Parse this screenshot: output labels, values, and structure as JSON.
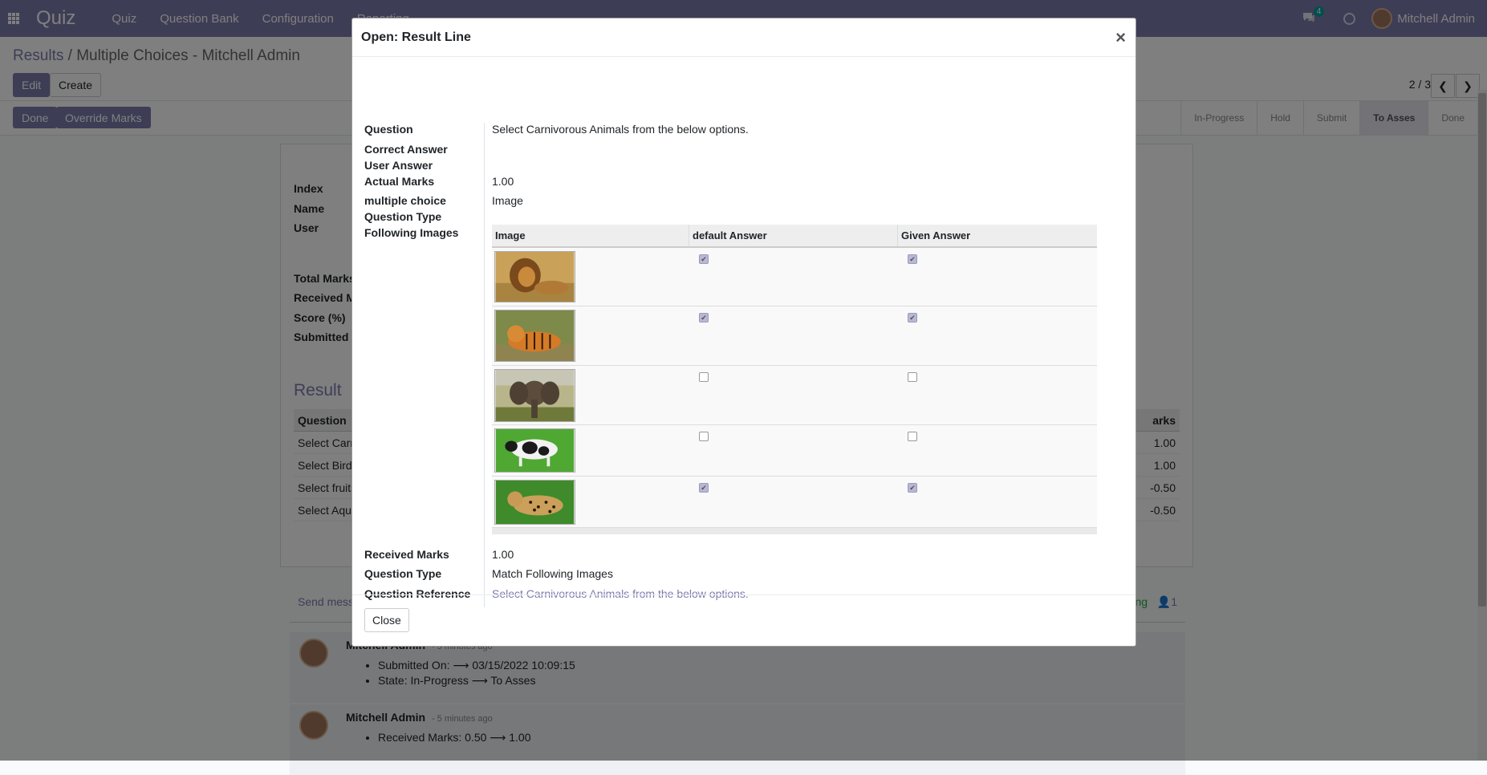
{
  "topbar": {
    "brand": "Quiz",
    "menu": [
      "Quiz",
      "Question Bank",
      "Configuration",
      "Reporting"
    ],
    "chat_count": "4",
    "user": "Mitchell Admin",
    "accent": "#7c7bad"
  },
  "control": {
    "breadcrumb_root": "Results",
    "breadcrumb_sep": "/",
    "breadcrumb_current": "Multiple Choices - Mitchell Admin",
    "edit_label": "Edit",
    "create_label": "Create",
    "pager": "2 / 3",
    "done_label": "Done",
    "override_label": "Override Marks",
    "stages": [
      "In-Progress",
      "Hold",
      "Submit",
      "To Asses",
      "Done"
    ],
    "active_stage": "To Asses"
  },
  "sheet": {
    "labels": [
      "Index",
      "Name",
      "User",
      "Total Marks",
      "Received M",
      "Score (%)",
      "Submitted C"
    ],
    "result_title": "Result",
    "result_head_left": "Question",
    "result_head_right": "arks",
    "result_rows": [
      {
        "q": "Select Carn",
        "m": "1.00"
      },
      {
        "q": "Select Birds",
        "m": "1.00"
      },
      {
        "q": "Select fruits",
        "m": "-0.50"
      },
      {
        "q": "Select Aqua",
        "m": "-0.50"
      }
    ]
  },
  "chatter": {
    "send_message": "Send messa",
    "following": "ng",
    "followers": "1",
    "messages": [
      {
        "author": "Mitchell Admin",
        "time": "- 5 minutes ago",
        "lines": [
          "Submitted On: ⟶ 03/15/2022 10:09:15",
          "State: In-Progress ⟶ To Asses"
        ]
      },
      {
        "author": "Mitchell Admin",
        "time": "- 5 minutes ago",
        "lines": [
          "Received Marks: 0.50 ⟶ 1.00"
        ]
      }
    ]
  },
  "modal": {
    "title": "Open: Result Line",
    "close_x": "×",
    "fields": {
      "question_label": "Question",
      "question_value": "Select Carnivorous Animals from the below options.",
      "correct_answer_label": "Correct Answer",
      "user_answer_label": "User Answer",
      "actual_marks_label": "Actual Marks",
      "actual_marks_value": "1.00",
      "mc_type_label_1": "multiple choice",
      "mc_type_label_2": "Question Type",
      "mc_type_value": "Image",
      "following_images_label": "Following Images",
      "received_marks_label": "Received Marks",
      "received_marks_value": "1.00",
      "question_type_label": "Question Type",
      "question_type_value": "Match Following Images",
      "question_ref_label": "Question Reference",
      "question_ref_value": "Select Carnivorous Animals from the below options."
    },
    "table": {
      "headers": [
        "Image",
        "default Answer",
        "Given Answer"
      ],
      "rows": [
        {
          "image": "lion",
          "default": true,
          "given": true
        },
        {
          "image": "tiger",
          "default": true,
          "given": true
        },
        {
          "image": "elephant",
          "default": false,
          "given": false
        },
        {
          "image": "cow",
          "default": false,
          "given": false
        },
        {
          "image": "leopard",
          "default": true,
          "given": true
        }
      ]
    },
    "footer_close": "Close"
  }
}
